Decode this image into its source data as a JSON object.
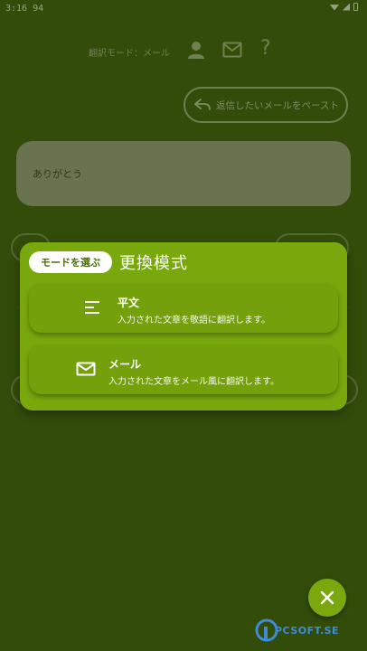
{
  "status_bar": {
    "time": "3:16 94"
  },
  "header": {
    "mode_label": "翻訳モード：メール"
  },
  "paste_button": {
    "label": "返信したいメールをペースト"
  },
  "message": {
    "text": "ありがとう"
  },
  "mode_dialog": {
    "chip_label": "モードを選ぶ",
    "title": "更換模式",
    "options": [
      {
        "title": "平文",
        "description": "入力された文章を敬語に翻訳します。",
        "icon": "text-lines-icon"
      },
      {
        "title": "メール",
        "description": "入力された文章をメール風に翻訳します。",
        "icon": "mail-icon"
      }
    ]
  },
  "close_button": {
    "icon": "close-icon"
  },
  "watermark": {
    "text": "PCSOFT.SE"
  },
  "colors": {
    "background": "#3f5a0f",
    "panel": "#79a80d",
    "option": "#74a10b",
    "message_box": "#8b9170",
    "chip_text": "#4b6d06"
  }
}
